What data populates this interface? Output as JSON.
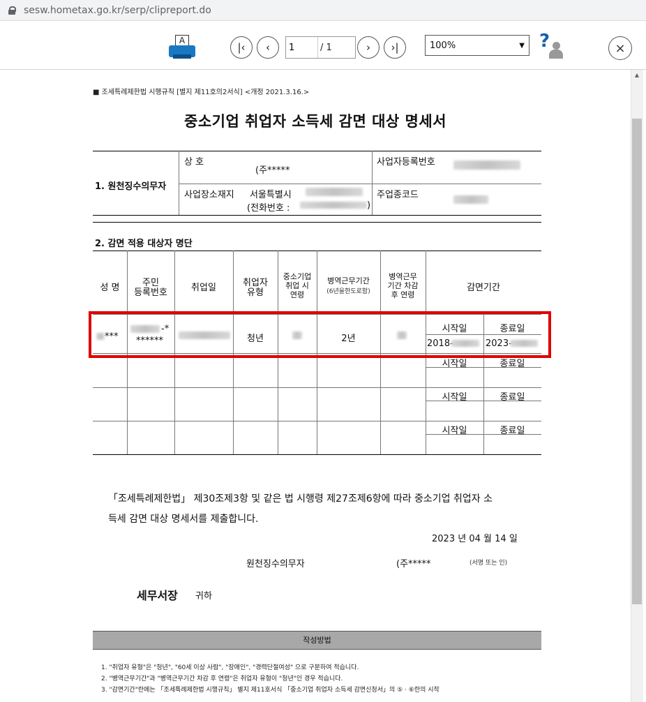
{
  "browser": {
    "url": "sesw.hometax.go.kr/serp/clipreport.do"
  },
  "toolbar": {
    "print_glyph": "A",
    "first": "|‹",
    "prev": "‹",
    "next": "›",
    "last": "›|",
    "page_current": "1",
    "page_total": "/ 1",
    "zoom": "100%",
    "help": "?",
    "close": "×"
  },
  "doc": {
    "form_ref": "■ 조세특례제한법 시행규칙 [별지 제11호의2서식] <개정 2021.3.16.>",
    "title": "중소기업 취업자 소득세 감면 대상 명세서",
    "section1": "1. 원천징수의무자",
    "label_company": "상 호",
    "value_company": "(주*****",
    "label_bizno": "사업자등록번호",
    "label_address": "사업장소재지",
    "value_city": "서울특별시",
    "label_phone": "(전화번호 :",
    "phone_close": ")",
    "label_industry": "주업종코드",
    "section2": "2. 감면 적용 대상자 명단",
    "col_name": "성  명",
    "col_rrn_1": "주민",
    "col_rrn_2": "등록번호",
    "col_hire": "취업일",
    "col_type_1": "취업자",
    "col_type_2": "유형",
    "col_age_1": "중소기업",
    "col_age_2": "취업 시",
    "col_age_3": "연령",
    "col_mil_1": "병역근무기간",
    "col_mil_2": "(6년을한도로함)",
    "col_adj_1": "병역근무",
    "col_adj_2": "기간 차감",
    "col_adj_3": "후 연령",
    "col_period": "감면기간",
    "start": "시작일",
    "end": "종료일",
    "row1": {
      "name": "***",
      "rrn_1": "-*",
      "rrn_2": "******",
      "type": "청년",
      "military": "2년",
      "start_date": "2018-",
      "end_date": "2023-"
    },
    "para_1": "「조세특례제한법」 제30조제3항 및 같은 법 시행령 제27조제6항에 따라 중소기업 취업자 소",
    "para_2": "득세 감면 대상 명세서를 제출합니다.",
    "date_year": "2023",
    "date_y": "년",
    "date_month": "04",
    "date_m": "월",
    "date_day": "14",
    "date_d": "일",
    "withholder": "원천징수의무자",
    "withholder_name": "(주*****",
    "sign": "(서명 또는 인)",
    "tax_office": "세무서장",
    "honorific": "귀하",
    "instructions_title": "작성방법",
    "note_1": "1.   \"취업자 유형\"은 \"청년\", \"60세 이상 사람\", \"장애인\", \"경력단절여성\" 으로 구분하여 적습니다.",
    "note_2": "2.   \"병역근무기간\"과 \"병역근무기간 차감 후 연령\"은 취업자 유형이 \"청년\"인 경우 적습니다.",
    "note_3": "3.   \"감면기간\"란에는 「조세특례제한법 시행규칙」 별지 제11호서식 「중소기업 취업자 소득세 감면신청서」의 ⑤ · ⑥란의 시작"
  }
}
